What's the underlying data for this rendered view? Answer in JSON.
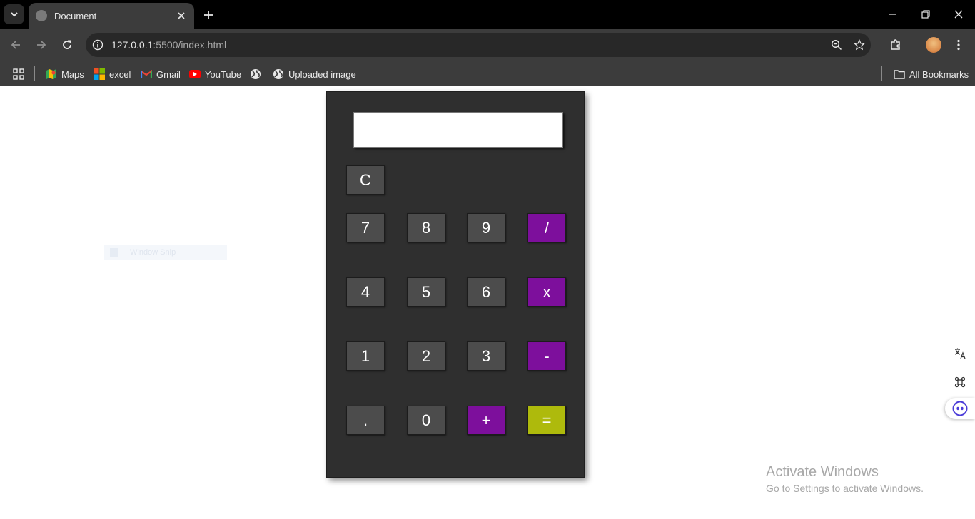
{
  "browser": {
    "tab_title": "Document",
    "url_host": "127.0.0.1",
    "url_rest": ":5500/index.html",
    "bookmarks": [
      {
        "label": "Maps",
        "icon": "maps-icon"
      },
      {
        "label": "excel",
        "icon": "microsoft-icon"
      },
      {
        "label": "Gmail",
        "icon": "gmail-icon"
      },
      {
        "label": "YouTube",
        "icon": "youtube-icon"
      },
      {
        "label": "",
        "icon": "globe-icon"
      },
      {
        "label": "Uploaded image",
        "icon": "globe-icon"
      }
    ],
    "all_bookmarks": "All Bookmarks"
  },
  "page": {
    "snap_hint": "Window Snip",
    "display_value": ""
  },
  "calculator": {
    "clear": "C",
    "rows": [
      [
        "7",
        "8",
        "9",
        "/"
      ],
      [
        "4",
        "5",
        "6",
        "x"
      ],
      [
        "1",
        "2",
        "3",
        "-"
      ],
      [
        ".",
        "0",
        "+",
        "="
      ]
    ]
  },
  "colors": {
    "operator": "#7d0f9c",
    "equals": "#aeba0c",
    "number": "#4c4c4c",
    "calc_body": "#2f2f2f"
  },
  "watermark": {
    "line1": "Activate Windows",
    "line2": "Go to Settings to activate Windows."
  }
}
